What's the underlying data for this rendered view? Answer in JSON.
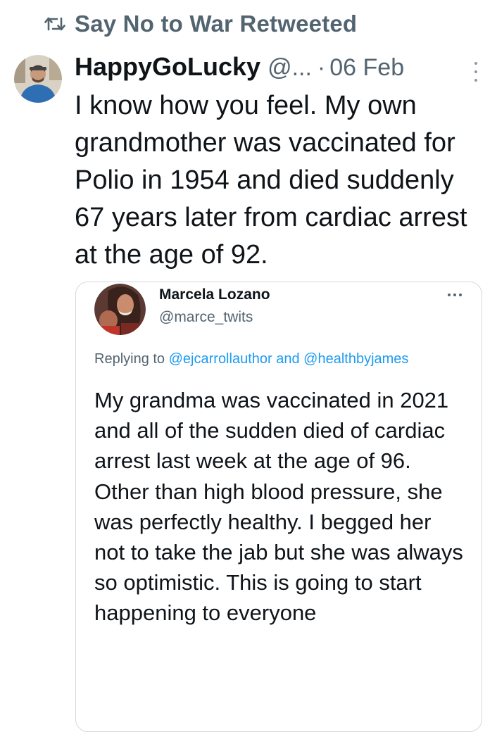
{
  "retweet": {
    "label": "Say No to War Retweeted",
    "icon": "retweet-icon"
  },
  "tweet": {
    "display_name": "HappyGoLucky",
    "handle": "@...",
    "separator": "·",
    "date": "06 Feb",
    "text": "I know how you feel. My own grandmother was vaccinated for Polio in 1954 and died suddenly 67 years later from cardiac arrest at the age of 92."
  },
  "quoted": {
    "display_name": "Marcela Lozano",
    "handle": "@marce_twits",
    "replying_prefix": "Replying to",
    "mention_1": "@ejcarrollauthor",
    "conjunction": "and",
    "mention_2": "@healthbyjames",
    "text": "My grandma was vaccinated in 2021 and all of the sudden died of cardiac arrest last week at the age of 96. Other than high blood pressure, she was perfectly healthy. I begged her not to take the jab but she was always so optimistic. This is going to start happening to everyone"
  },
  "colors": {
    "text_primary": "#0f1419",
    "text_secondary": "#536471",
    "link": "#1d9bf0",
    "border": "#cfd9de"
  }
}
